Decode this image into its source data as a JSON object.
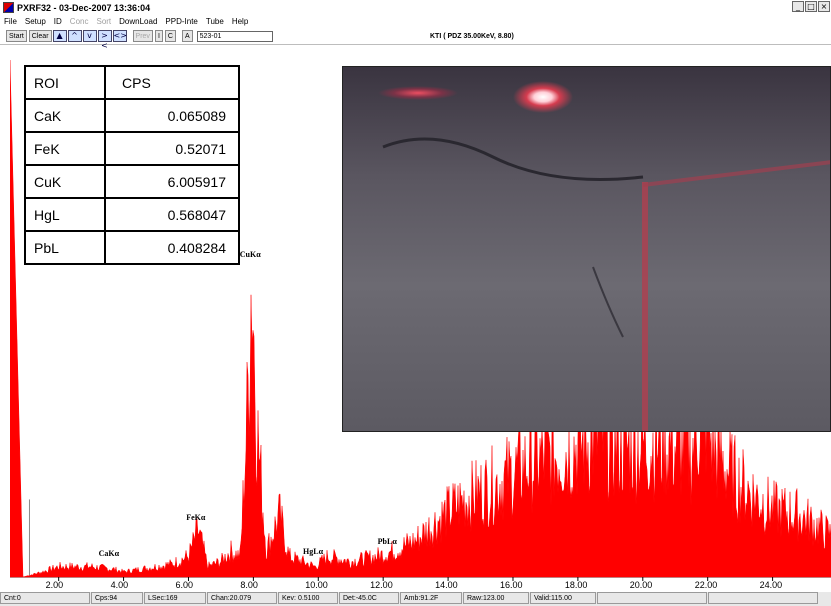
{
  "window": {
    "title": "PXRF32 - 03-Dec-2007 13:36:04",
    "buttons": [
      "_",
      "□",
      "×"
    ]
  },
  "menu": [
    {
      "label": "File",
      "enabled": true
    },
    {
      "label": "Setup",
      "enabled": true
    },
    {
      "label": "ID",
      "enabled": true
    },
    {
      "label": "Conc",
      "enabled": false
    },
    {
      "label": "Sort",
      "enabled": false
    },
    {
      "label": "DownLoad",
      "enabled": true
    },
    {
      "label": "PPD-Inte",
      "enabled": true
    },
    {
      "label": "Tube",
      "enabled": true
    },
    {
      "label": "Help",
      "enabled": true
    }
  ],
  "toolbar": {
    "start_label": "Start",
    "clear_label": "Clear",
    "prev_label": "Prev",
    "i_label": "I",
    "c_label": "C",
    "a_label": "A",
    "sample_value": "523-01",
    "status_info": "KTI  ( PDZ 35.00KeV, 8.80)"
  },
  "roi_table": {
    "headers": [
      "ROI",
      "CPS"
    ],
    "rows": [
      [
        "CaK",
        "0.065089"
      ],
      [
        "FeK",
        "0.52071"
      ],
      [
        "CuK",
        "6.005917"
      ],
      [
        "HgL",
        "0.568047"
      ],
      [
        "PbL",
        "0.408284"
      ]
    ]
  },
  "chart_data": {
    "type": "area",
    "xlim": [
      0.5,
      25.8
    ],
    "ylim": [
      0,
      1
    ],
    "xticks": [
      "2.00",
      "4.00",
      "6.00",
      "8.00",
      "10.00",
      "12.00",
      "14.00",
      "16.00",
      "18.00",
      "20.00",
      "22.00",
      "24.00"
    ],
    "color": "#ff0000",
    "series_points": [
      [
        0.5,
        1.0
      ],
      [
        0.9,
        0.0
      ],
      [
        1.5,
        0.01
      ],
      [
        2.0,
        0.02
      ],
      [
        3.0,
        0.02
      ],
      [
        3.7,
        0.015
      ],
      [
        4.0,
        0.01
      ],
      [
        5.0,
        0.02
      ],
      [
        5.5,
        0.025
      ],
      [
        6.0,
        0.04
      ],
      [
        6.3,
        0.09
      ],
      [
        6.6,
        0.02
      ],
      [
        7.0,
        0.03
      ],
      [
        7.3,
        0.05
      ],
      [
        7.6,
        0.04
      ],
      [
        7.8,
        0.3
      ],
      [
        7.95,
        0.6
      ],
      [
        8.1,
        0.3
      ],
      [
        8.4,
        0.05
      ],
      [
        8.8,
        0.12
      ],
      [
        9.1,
        0.04
      ],
      [
        9.5,
        0.03
      ],
      [
        9.9,
        0.02
      ],
      [
        10.3,
        0.04
      ],
      [
        11.0,
        0.03
      ],
      [
        11.8,
        0.04
      ],
      [
        12.3,
        0.05
      ],
      [
        13.0,
        0.07
      ],
      [
        13.7,
        0.11
      ],
      [
        14.5,
        0.15
      ],
      [
        15.5,
        0.18
      ],
      [
        16.5,
        0.22
      ],
      [
        17.5,
        0.24
      ],
      [
        18.5,
        0.27
      ],
      [
        19.5,
        0.25
      ],
      [
        20.5,
        0.26
      ],
      [
        21.5,
        0.24
      ],
      [
        21.85,
        0.32
      ],
      [
        22.2,
        0.24
      ],
      [
        23.0,
        0.18
      ],
      [
        24.0,
        0.13
      ],
      [
        24.8,
        0.12
      ],
      [
        25.8,
        0.08
      ]
    ],
    "peak_labels": [
      {
        "label": "CaKα",
        "x": 3.6,
        "y": 0.03
      },
      {
        "label": "FeKα",
        "x": 6.3,
        "y": 0.1
      },
      {
        "label": "CuKα",
        "x": 7.95,
        "y": 0.61
      },
      {
        "label": "HgLα",
        "x": 9.9,
        "y": 0.035
      },
      {
        "label": "PbLα",
        "x": 12.2,
        "y": 0.055
      }
    ]
  },
  "statusbar": [
    "Cnt:0",
    "Cps:94",
    "LSec:169",
    "Chan:20.079",
    "Kev: 0.5100",
    "Det:-45.0C",
    "Amb:91.2F",
    "Raw:123.00",
    "Valid:115.00",
    "",
    ""
  ]
}
